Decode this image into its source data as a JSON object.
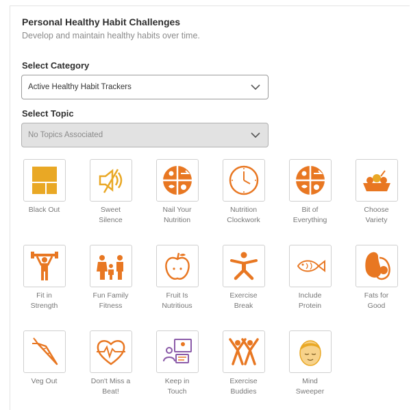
{
  "header": {
    "title": "Personal Healthy Habit Challenges",
    "subtitle": "Develop and maintain healthy habits over time."
  },
  "category": {
    "label": "Select Category",
    "value": "Active Healthy Habit Trackers"
  },
  "topic": {
    "label": "Select Topic",
    "value": "No Topics Associated"
  },
  "colors": {
    "accent": "#e87722",
    "accent_yellow": "#e9a825"
  },
  "challenges": [
    {
      "label": "Black Out",
      "icon": "blackout-window-icon"
    },
    {
      "label": "Sweet\nSilence",
      "icon": "muted-speaker-icon"
    },
    {
      "label": "Nail Your\nNutrition",
      "icon": "nutrition-plate-icon"
    },
    {
      "label": "Nutrition\nClockwork",
      "icon": "clock-icon"
    },
    {
      "label": "Bit of\nEverything",
      "icon": "food-plate-icon"
    },
    {
      "label": "Choose\nVariety",
      "icon": "vegetable-basket-icon"
    },
    {
      "label": "Fit in\nStrength",
      "icon": "weightlifter-icon"
    },
    {
      "label": "Fun Family\nFitness",
      "icon": "family-icon"
    },
    {
      "label": "Fruit Is\nNutritious",
      "icon": "apple-icon"
    },
    {
      "label": "Exercise\nBreak",
      "icon": "exercising-person-icon"
    },
    {
      "label": "Include\nProtein",
      "icon": "fish-icon"
    },
    {
      "label": "Fats for\nGood",
      "icon": "avocado-icon"
    },
    {
      "label": "Veg Out",
      "icon": "carrot-icon"
    },
    {
      "label": "Don't Miss a\nBeat!",
      "icon": "heartbeat-icon"
    },
    {
      "label": "Keep in\nTouch",
      "icon": "video-chat-icon"
    },
    {
      "label": "Exercise\nBuddies",
      "icon": "exercise-buddies-icon"
    },
    {
      "label": "Mind\nSweeper",
      "icon": "calm-face-icon"
    }
  ]
}
